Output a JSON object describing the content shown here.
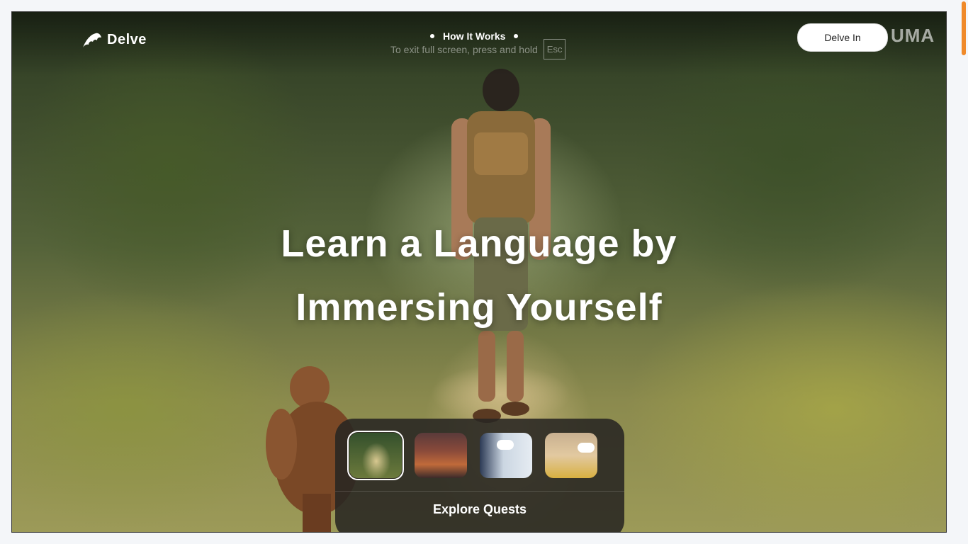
{
  "brand": {
    "name": "Delve",
    "logo_icon": "dolphin-icon"
  },
  "nav": {
    "items": [
      {
        "label": "How It Works"
      }
    ]
  },
  "fullscreen_hint": {
    "text": "To exit full screen, press and hold",
    "key": "Esc"
  },
  "header": {
    "cta_label": "Delve In",
    "watermark": "UMA"
  },
  "hero": {
    "line1": "Learn a Language by",
    "line2": "Immersing Yourself"
  },
  "quests": {
    "thumbnails": [
      {
        "name": "jungle-quest",
        "active": true
      },
      {
        "name": "city-quest",
        "active": false
      },
      {
        "name": "office-quest",
        "active": false
      },
      {
        "name": "cartoon-quest",
        "active": false
      }
    ],
    "explore_label": "Explore Quests"
  },
  "colors": {
    "accent": "#f08a2a",
    "panel": "#282622"
  }
}
